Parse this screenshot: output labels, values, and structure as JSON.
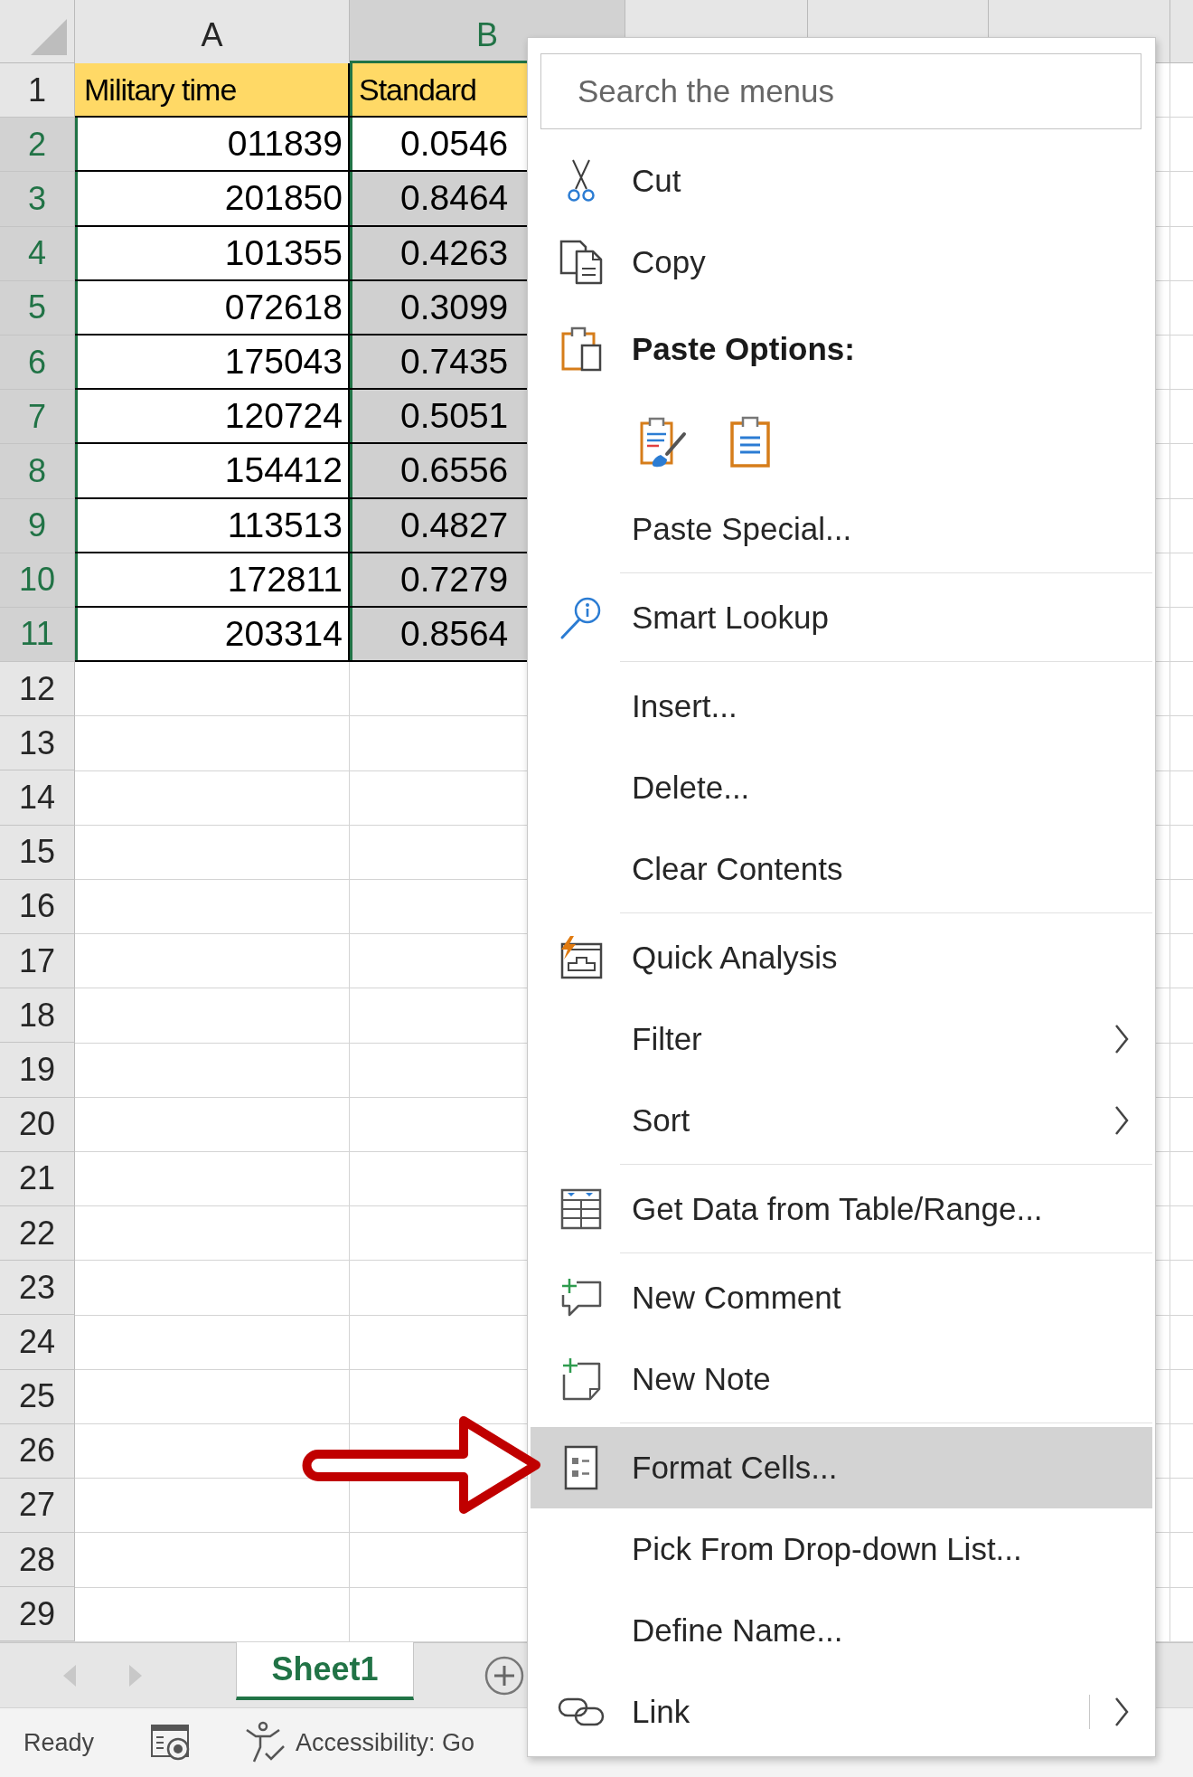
{
  "sheet": {
    "columns": [
      {
        "label": "A",
        "selected": false
      },
      {
        "label": "B",
        "selected": true
      }
    ],
    "rows": [
      {
        "number": "1",
        "selected": false,
        "cells": [
          {
            "kind": "heading",
            "text": "Military time",
            "selected": false
          },
          {
            "kind": "heading",
            "text": "Standard",
            "selected": false
          }
        ]
      },
      {
        "number": "2",
        "selected": true,
        "cells": [
          {
            "kind": "value",
            "text": "011839",
            "selected": false
          },
          {
            "kind": "value",
            "text": "0.0546",
            "selected": false
          }
        ]
      },
      {
        "number": "3",
        "selected": true,
        "cells": [
          {
            "kind": "value",
            "text": "201850",
            "selected": false
          },
          {
            "kind": "value",
            "text": "0.8464",
            "selected": true
          }
        ]
      },
      {
        "number": "4",
        "selected": true,
        "cells": [
          {
            "kind": "value",
            "text": "101355",
            "selected": false
          },
          {
            "kind": "value",
            "text": "0.4263",
            "selected": true
          }
        ]
      },
      {
        "number": "5",
        "selected": true,
        "cells": [
          {
            "kind": "value",
            "text": "072618",
            "selected": false
          },
          {
            "kind": "value",
            "text": "0.3099",
            "selected": true
          }
        ]
      },
      {
        "number": "6",
        "selected": true,
        "cells": [
          {
            "kind": "value",
            "text": "175043",
            "selected": false
          },
          {
            "kind": "value",
            "text": "0.7435",
            "selected": true
          }
        ]
      },
      {
        "number": "7",
        "selected": true,
        "cells": [
          {
            "kind": "value",
            "text": "120724",
            "selected": false
          },
          {
            "kind": "value",
            "text": "0.5051",
            "selected": true
          }
        ]
      },
      {
        "number": "8",
        "selected": true,
        "cells": [
          {
            "kind": "value",
            "text": "154412",
            "selected": false
          },
          {
            "kind": "value",
            "text": "0.6556",
            "selected": true
          }
        ]
      },
      {
        "number": "9",
        "selected": true,
        "cells": [
          {
            "kind": "value",
            "text": "113513",
            "selected": false
          },
          {
            "kind": "value",
            "text": "0.4827",
            "selected": true
          }
        ]
      },
      {
        "number": "10",
        "selected": true,
        "cells": [
          {
            "kind": "value",
            "text": "172811",
            "selected": false
          },
          {
            "kind": "value",
            "text": "0.7279",
            "selected": true
          }
        ]
      },
      {
        "number": "11",
        "selected": true,
        "cells": [
          {
            "kind": "value",
            "text": "203314",
            "selected": false
          },
          {
            "kind": "value",
            "text": "0.8564",
            "selected": true
          }
        ]
      },
      {
        "number": "12",
        "selected": false
      },
      {
        "number": "13",
        "selected": false
      },
      {
        "number": "14",
        "selected": false
      },
      {
        "number": "15",
        "selected": false
      },
      {
        "number": "16",
        "selected": false
      },
      {
        "number": "17",
        "selected": false
      },
      {
        "number": "18",
        "selected": false
      },
      {
        "number": "19",
        "selected": false
      },
      {
        "number": "20",
        "selected": false
      },
      {
        "number": "21",
        "selected": false
      },
      {
        "number": "22",
        "selected": false
      },
      {
        "number": "23",
        "selected": false
      },
      {
        "number": "24",
        "selected": false
      },
      {
        "number": "25",
        "selected": false
      },
      {
        "number": "26",
        "selected": false
      },
      {
        "number": "27",
        "selected": false
      },
      {
        "number": "28",
        "selected": false
      },
      {
        "number": "29",
        "selected": false
      }
    ]
  },
  "context_menu": {
    "search": {
      "placeholder": "Search the menus"
    },
    "groups": [
      [
        {
          "kind": "command",
          "label": "Cut",
          "selected": false
        },
        {
          "kind": "command",
          "label": "Copy",
          "selected": false
        },
        {
          "kind": "heading",
          "label": "Paste Options:"
        },
        {
          "kind": "paste-options",
          "options": [
            {
              "selected": false
            },
            {
              "selected": false
            }
          ]
        },
        {
          "kind": "command",
          "label": "Paste Special...",
          "selected": false
        }
      ],
      [
        {
          "kind": "command",
          "label": "Smart Lookup",
          "selected": false
        }
      ],
      [
        {
          "kind": "command",
          "label": "Insert...",
          "selected": false
        },
        {
          "kind": "command",
          "label": "Delete...",
          "selected": false
        },
        {
          "kind": "command",
          "label": "Clear Contents",
          "selected": false
        }
      ],
      [
        {
          "kind": "command",
          "label": "Quick Analysis",
          "selected": false
        },
        {
          "kind": "submenu",
          "label": "Filter",
          "selected": false
        },
        {
          "kind": "submenu",
          "label": "Sort",
          "selected": false
        }
      ],
      [
        {
          "kind": "command",
          "label": "Get Data from Table/Range...",
          "selected": false
        }
      ],
      [
        {
          "kind": "command",
          "label": "New Comment",
          "selected": false
        },
        {
          "kind": "command",
          "label": "New Note",
          "selected": false
        }
      ],
      [
        {
          "kind": "command",
          "label": "Format Cells...",
          "selected": true
        },
        {
          "kind": "command",
          "label": "Pick From Drop-down List...",
          "selected": false
        },
        {
          "kind": "command",
          "label": "Define Name...",
          "selected": false
        },
        {
          "kind": "split",
          "label": "Link",
          "selected": false
        }
      ]
    ]
  },
  "sheet_tabs": {
    "back_disabled": true,
    "forward_disabled": true,
    "tabs": [
      {
        "label": "Sheet1",
        "selected": true
      }
    ]
  },
  "status_bar": {
    "status": "Ready",
    "accessibility": "Accessibility: Go"
  }
}
